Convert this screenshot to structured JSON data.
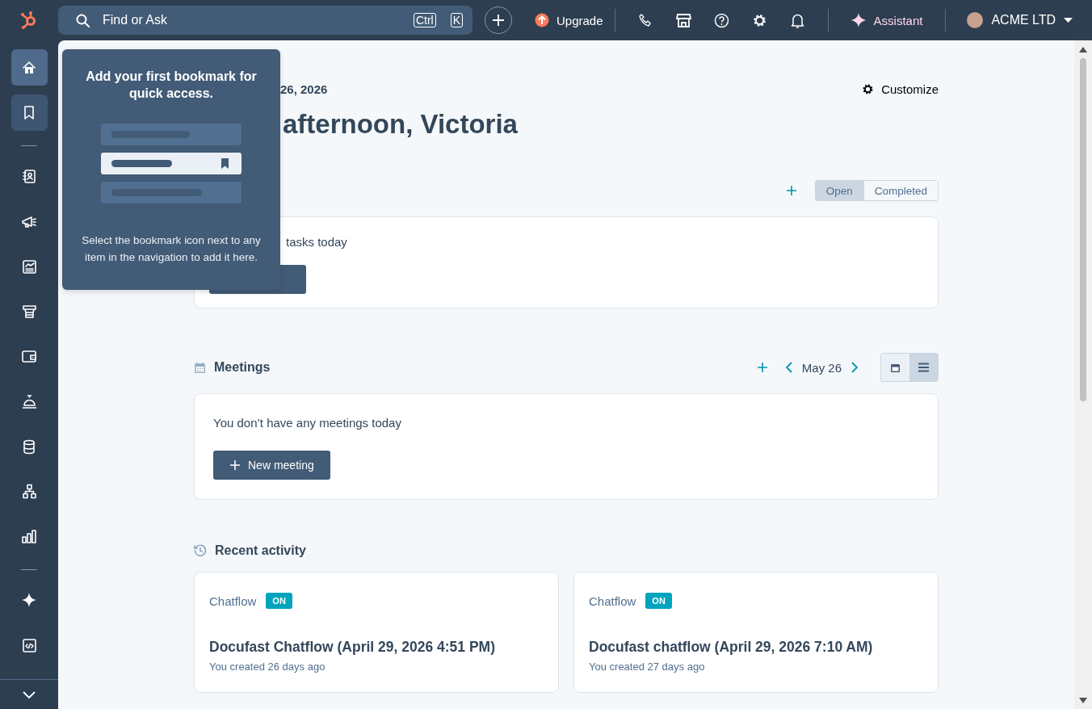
{
  "topbar": {
    "search": {
      "placeholder": "Find or Ask",
      "shortcut": [
        "Ctrl",
        "K"
      ]
    },
    "upgrade": "Upgrade",
    "assistant": "Assistant",
    "account": "ACME LTD"
  },
  "sidebar": {
    "items": [
      {
        "selected": true,
        "open": false
      },
      {
        "selected": false,
        "open": true
      },
      {
        "selected": false,
        "open": false
      },
      {
        "selected": false,
        "open": false
      },
      {
        "selected": false,
        "open": false
      },
      {
        "selected": false,
        "open": false
      },
      {
        "selected": false,
        "open": false
      },
      {
        "selected": false,
        "open": false
      },
      {
        "selected": false,
        "open": false
      },
      {
        "selected": false,
        "open": false
      },
      {
        "selected": false,
        "open": false
      },
      {
        "selected": false,
        "open": false
      },
      {
        "selected": false,
        "open": false
      }
    ]
  },
  "bookmark_popover": {
    "title": "Add your first bookmark for quick access.",
    "body": "Select the bookmark icon next to any item in the navigation to add it here."
  },
  "dashboard": {
    "date": "26, 2026",
    "greeting": "afternoon, Victoria",
    "customize": "Customize"
  },
  "tasks": {
    "filters": [
      {
        "label": "Open",
        "selected": true
      },
      {
        "label": "Completed",
        "selected": false
      }
    ],
    "empty": "tasks today"
  },
  "meetings": {
    "title": "Meetings",
    "date": "May 26",
    "views": [
      {
        "selected": false
      },
      {
        "selected": true
      }
    ],
    "empty": "You don’t have any meetings today",
    "button": "New meeting"
  },
  "recent_activity": {
    "title": "Recent activity",
    "cards": [
      {
        "type": "Chatflow",
        "status": "ON",
        "title": "Docufast Chatflow (April 29, 2026 4:51 PM)",
        "meta": "You created 26 days ago"
      },
      {
        "type": "Chatflow",
        "status": "ON",
        "title": "Docufast chatflow (April 29, 2026 7:10 AM)",
        "meta": "You created 27 days ago"
      }
    ]
  }
}
